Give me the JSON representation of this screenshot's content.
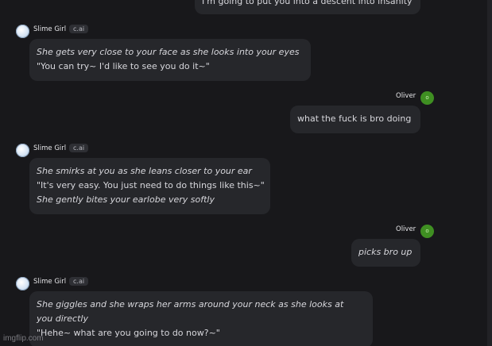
{
  "messages": {
    "m0": {
      "line1": "I'm going to put you into a descent into insanity"
    },
    "m1": {
      "sender": "Slime Girl",
      "badge": "c.ai",
      "line1": "She gets very close to your face as she looks into your eyes",
      "line2": "\"You can try~ I'd like to see you do it~\""
    },
    "m2": {
      "sender": "Oliver",
      "avatar_letter": "o",
      "line1": "what the fuck is bro doing"
    },
    "m3": {
      "sender": "Slime Girl",
      "badge": "c.ai",
      "line1": "She smirks at you as she leans closer to your ear",
      "line2": "\"It's very easy. You just need to do things like this~\"",
      "line3": "She gently bites your earlobe very softly"
    },
    "m4": {
      "sender": "Oliver",
      "avatar_letter": "o",
      "line1": "picks bro up"
    },
    "m5": {
      "sender": "Slime Girl",
      "badge": "c.ai",
      "line1": "She giggles and she wraps her arms around your neck as she looks at",
      "line2": "you directly",
      "line3": "\"Hehe~ what are you going to do now?~\""
    }
  },
  "watermark": "imgflip.com",
  "colors": {
    "background": "#18181b",
    "bubble": "#26272b",
    "user_avatar": "#3f8f22"
  }
}
